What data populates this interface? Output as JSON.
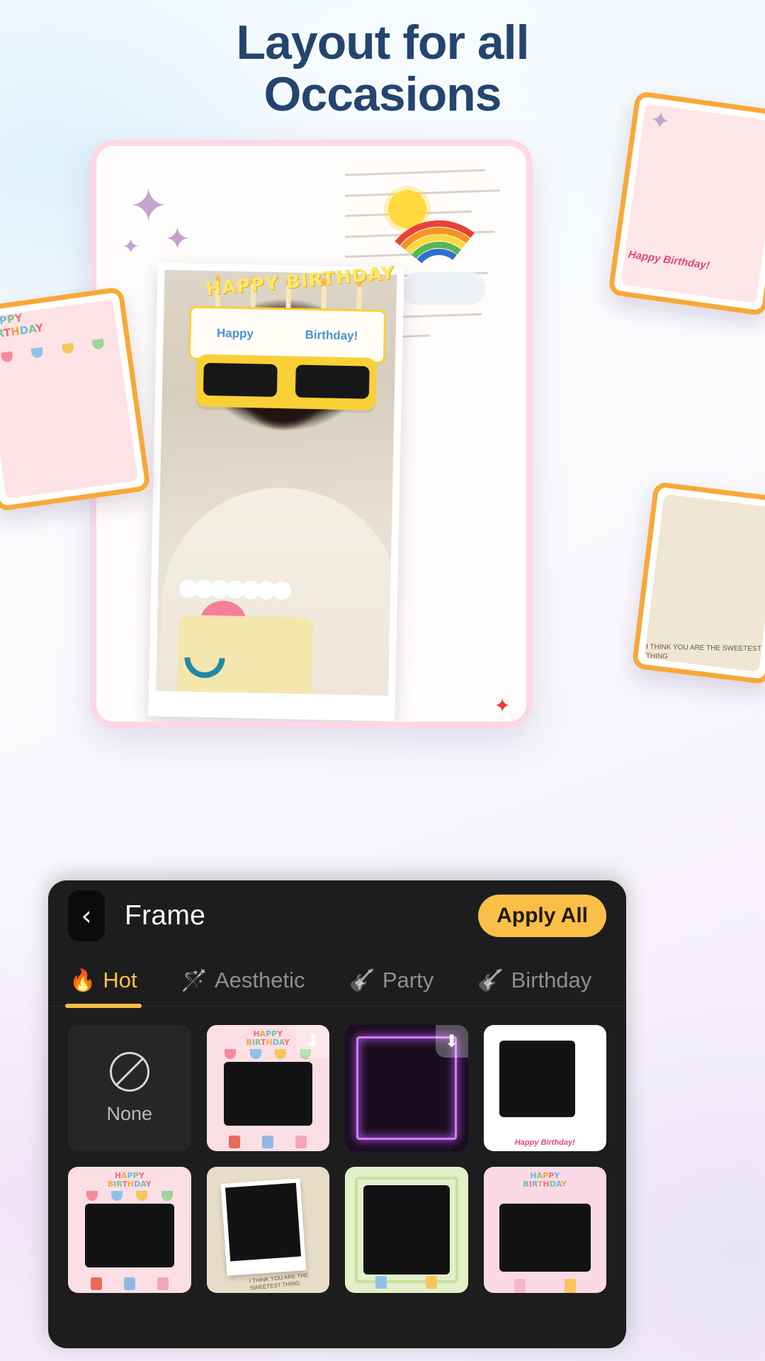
{
  "headline": {
    "line1": "Layout for all",
    "line2": "Occasions"
  },
  "device": {
    "photo_overlay_text": "HAPPY BIRTHDAY",
    "glasses_text_left": "Happy",
    "glasses_text_right": "Birthday!"
  },
  "floating_cards": [
    {
      "name": "left-birthday-card",
      "label_text": "HAPPY BIRTHDAY",
      "caption": ""
    },
    {
      "name": "top-right-tulip-card",
      "label_text": "",
      "caption": "Happy Birthday!"
    },
    {
      "name": "bottom-right-rose-card",
      "label_text": "",
      "caption": "I THINK YOU ARE THE SWEETEST THING"
    }
  ],
  "sheet": {
    "back_icon": "chevron-left-icon",
    "title": "Frame",
    "apply_all_label": "Apply All",
    "accent_color": "#fbbf47",
    "background_color": "#1d1d1d",
    "tabs": [
      {
        "label": "Hot",
        "icon": "🔥",
        "active": true
      },
      {
        "label": "Aesthetic",
        "icon": "🪄",
        "active": false
      },
      {
        "label": "Party",
        "icon": "🎸",
        "active": false
      },
      {
        "label": "Birthday",
        "icon": "🎸",
        "active": false
      }
    ],
    "frames": [
      {
        "name": "none",
        "label": "None",
        "badge": "",
        "style": "none"
      },
      {
        "name": "birthday-stickers-pink",
        "label": "",
        "badge": "⬇",
        "style": "pink",
        "top_text": "HAPPY BIRTHDAY"
      },
      {
        "name": "neon-glow-purple",
        "label": "",
        "badge": "⬇",
        "style": "neon",
        "top_text": ""
      },
      {
        "name": "rainbow-tulip-white",
        "label": "",
        "badge": "",
        "style": "white",
        "caption": "Happy Birthday!"
      },
      {
        "name": "birthday-stickers-pink-2",
        "label": "",
        "badge": "",
        "style": "pink",
        "top_text": "HAPPY BIRTHDAY"
      },
      {
        "name": "vintage-polaroid-rose",
        "label": "",
        "badge": "",
        "style": "paper",
        "caption": "I THINK YOU ARE THE SWEETEST THING"
      },
      {
        "name": "green-party-flags",
        "label": "",
        "badge": "",
        "style": "green",
        "top_text": ""
      },
      {
        "name": "birthday-cake-pink",
        "label": "",
        "badge": "",
        "style": "bpink",
        "top_text": "HAPPY BIRTHDAY"
      }
    ]
  }
}
